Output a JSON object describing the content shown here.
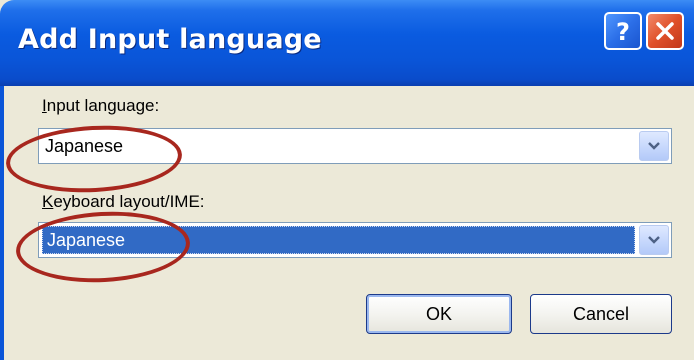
{
  "window": {
    "title": "Add Input language",
    "help_button_glyph": "?",
    "close_button_icon": "close-icon"
  },
  "input_language": {
    "label_underlined": "I",
    "label_rest": "nput language:",
    "value": "Japanese"
  },
  "keyboard_layout": {
    "label_underlined": "K",
    "label_rest": "eyboard layout/IME:",
    "value": "Japanese"
  },
  "buttons": {
    "ok_label": "OK",
    "cancel_label": "Cancel"
  },
  "colors": {
    "titlebar": "#0a55d8",
    "selection": "#316ac5",
    "annotation": "#a8271e",
    "dialog_face": "#ece9d8"
  }
}
